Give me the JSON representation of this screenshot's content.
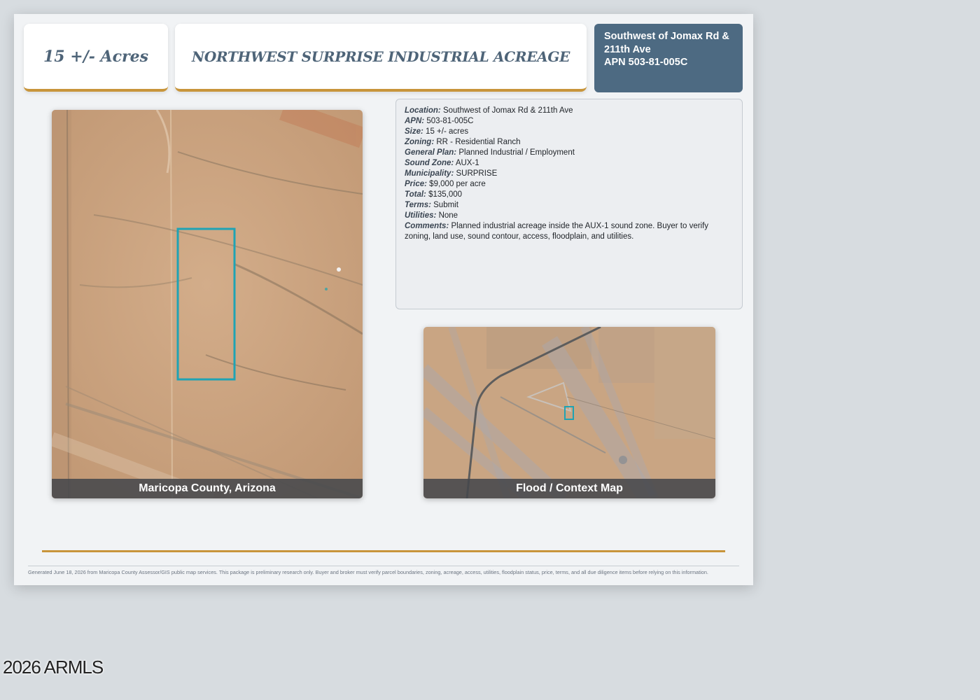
{
  "header": {
    "acres": "15 +/- Acres",
    "title": "NORTHWEST SURPRISE INDUSTRIAL ACREAGE",
    "address_line1": "Southwest of Jomax Rd &",
    "address_line2": "211th Ave",
    "apn_line": "APN 503-81-005C"
  },
  "photos": {
    "aerial_caption": "Maricopa County, Arizona",
    "context_caption": "Flood / Context Map"
  },
  "details": [
    {
      "label": "Location:",
      "value": "Southwest of Jomax Rd & 211th Ave"
    },
    {
      "label": "APN:",
      "value": "503-81-005C"
    },
    {
      "label": "Size:",
      "value": "15 +/- acres"
    },
    {
      "label": "Zoning:",
      "value": "RR - Residential Ranch"
    },
    {
      "label": "General Plan:",
      "value": "Planned Industrial / Employment"
    },
    {
      "label": "Sound Zone:",
      "value": "AUX-1"
    },
    {
      "label": "Municipality:",
      "value": "SURPRISE"
    },
    {
      "label": "Price:",
      "value": "$9,000 per acre"
    },
    {
      "label": "Total:",
      "value": "$135,000"
    },
    {
      "label": "Terms:",
      "value": "Submit"
    },
    {
      "label": "Utilities:",
      "value": "None"
    },
    {
      "label": "Comments:",
      "value": "Planned industrial acreage inside the AUX-1 sound zone. Buyer to verify zoning, land use, sound contour, access, floodplain, and utilities."
    }
  ],
  "footer": {
    "disclaimer": "Generated June 18, 2026 from Maricopa County Assessor/GIS public map services. This package is preliminary research only. Buyer and broker must verify parcel boundaries, zoning, acreage, access, utilities, floodplain status, price, terms, and all due diligence items before relying on this information."
  },
  "watermark": "2026 ARMLS",
  "colors": {
    "accent_gold": "#c8953b",
    "slate_blue": "#4d6a82",
    "parcel_outline": "#1fa3b4",
    "desert": "#c9a27e"
  }
}
